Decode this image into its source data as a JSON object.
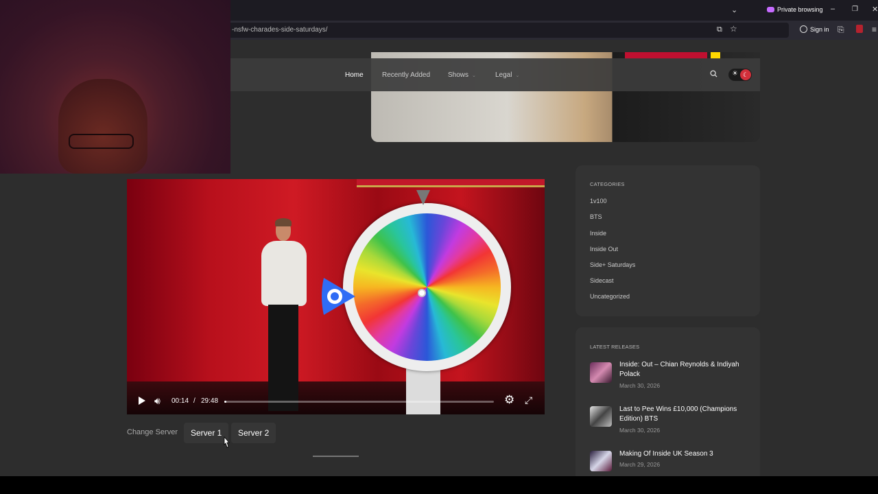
{
  "browser": {
    "url": "-nsfw-charades-side-saturdays/",
    "private_label": "Private browsing",
    "signin_label": "Sign in"
  },
  "nav": {
    "items": [
      {
        "label": "Home",
        "has_menu": false
      },
      {
        "label": "Recently Added",
        "has_menu": false
      },
      {
        "label": "Shows",
        "has_menu": true
      },
      {
        "label": "Legal",
        "has_menu": true
      }
    ]
  },
  "player": {
    "current_time": "00:14",
    "separator": "/",
    "duration": "29:48",
    "progress_fraction": 0.008
  },
  "servers": {
    "label": "Change Server",
    "options": [
      "Server 1",
      "Server 2"
    ]
  },
  "sidebar": {
    "categories": {
      "title": "CATEGORIES",
      "items": [
        "1v100",
        "BTS",
        "Inside",
        "Inside Out",
        "Side+ Saturdays",
        "Sidecast",
        "Uncategorized"
      ]
    },
    "releases": {
      "title": "LATEST RELEASES",
      "items": [
        {
          "title": "Inside: Out – Chian Reynolds & Indiyah Polack",
          "date": "March 30, 2026"
        },
        {
          "title": "Last to Pee Wins £10,000 (Champions Edition) BTS",
          "date": "March 30, 2026"
        },
        {
          "title": "Making Of Inside UK Season 3",
          "date": "March 29, 2026"
        }
      ]
    }
  },
  "colors": {
    "page_bg": "#2d2d2d",
    "card_bg": "#333333",
    "accent_red": "#d3303b",
    "private_purple": "#c66bff"
  }
}
